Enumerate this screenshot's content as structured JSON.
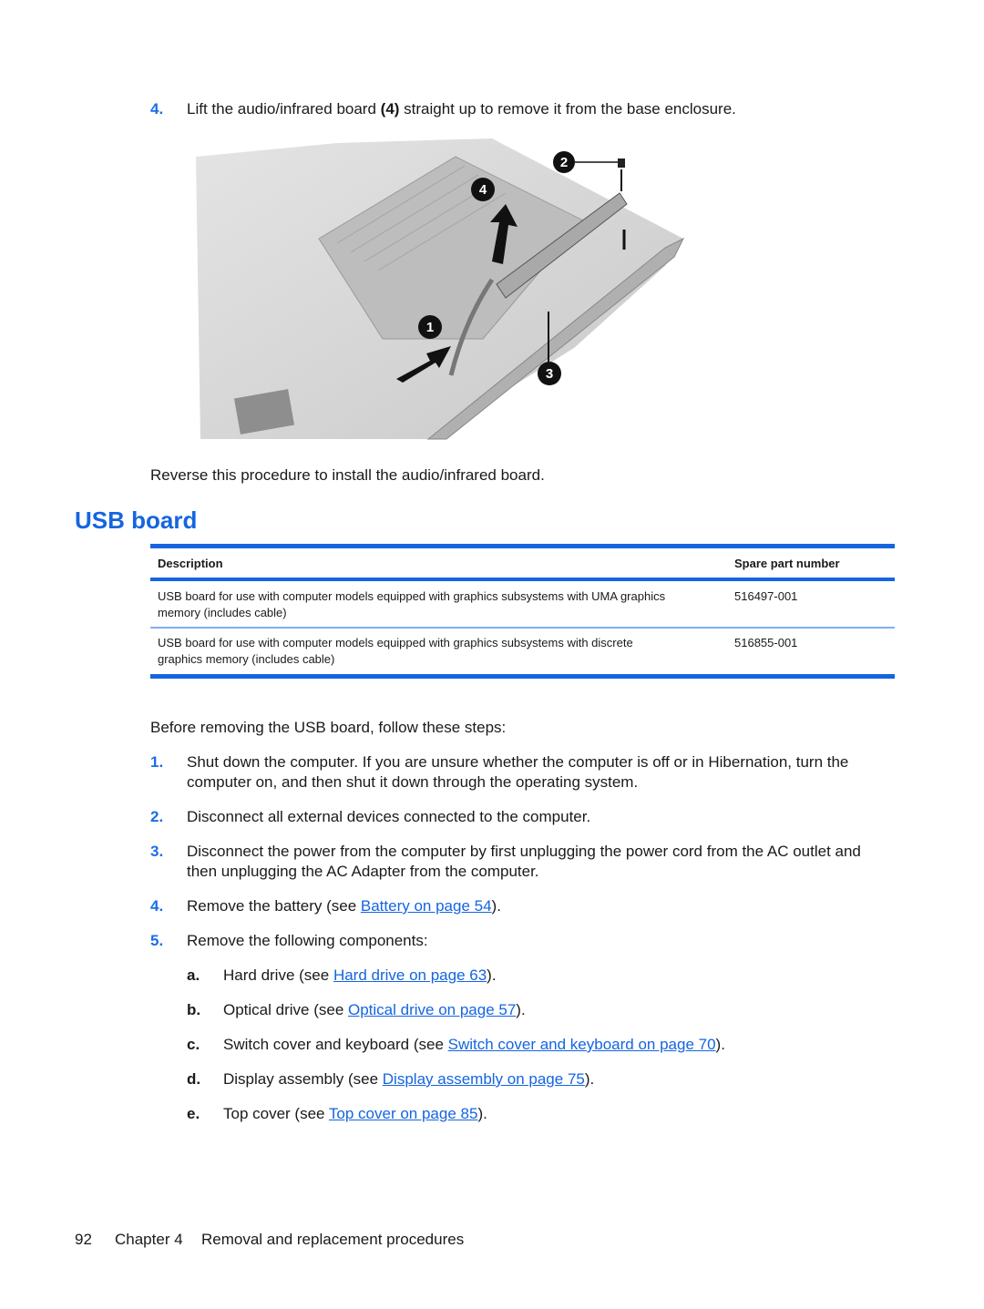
{
  "top_step": {
    "number": "4.",
    "text_before": "Lift the audio/infrared board ",
    "bold": "(4)",
    "text_after": " straight up to remove it from the base enclosure."
  },
  "figure": {
    "callouts": [
      "1",
      "2",
      "3",
      "4"
    ],
    "description": "Illustration of audio/infrared board removal from base enclosure"
  },
  "reverse_note": "Reverse this procedure to install the audio/infrared board.",
  "section_title": "USB board",
  "table": {
    "headers": [
      "Description",
      "Spare part number"
    ],
    "rows": [
      {
        "description_line1": "USB board for use with computer models equipped with graphics subsystems with UMA graphics",
        "description_line2": "memory (includes cable)",
        "part": "516497-001"
      },
      {
        "description_line1": "USB board for use with computer models equipped with graphics subsystems with discrete",
        "description_line2": "graphics memory (includes cable)",
        "part": "516855-001"
      }
    ]
  },
  "intro": "Before removing the USB board, follow these steps:",
  "steps": [
    {
      "number": "1.",
      "line1": "Shut down the computer. If you are unsure whether the computer is off or in Hibernation, turn the",
      "line2": "computer on, and then shut it down through the operating system."
    },
    {
      "number": "2.",
      "line1": "Disconnect all external devices connected to the computer."
    },
    {
      "number": "3.",
      "line1": "Disconnect the power from the computer by first unplugging the power cord from the AC outlet and",
      "line2": "then unplugging the AC Adapter from the computer."
    },
    {
      "number": "4.",
      "before": "Remove the battery (see ",
      "link": "Battery on page 54",
      "after": ")."
    },
    {
      "number": "5.",
      "line1": "Remove the following components:"
    }
  ],
  "substeps": [
    {
      "letter": "a.",
      "before": "Hard drive (see ",
      "link": "Hard drive on page 63",
      "after": ")."
    },
    {
      "letter": "b.",
      "before": "Optical drive (see ",
      "link": "Optical drive on page 57",
      "after": ")."
    },
    {
      "letter": "c.",
      "before": "Switch cover and keyboard (see ",
      "link": "Switch cover and keyboard on page 70",
      "after": ")."
    },
    {
      "letter": "d.",
      "before": "Display assembly (see ",
      "link": "Display assembly on page 75",
      "after": ")."
    },
    {
      "letter": "e.",
      "before": "Top cover (see ",
      "link": "Top cover on page 85",
      "after": ")."
    }
  ],
  "footer": {
    "page": "92",
    "chapter": "Chapter 4",
    "title": "Removal and replacement procedures"
  },
  "colors": {
    "accent": "#1565e0",
    "link": "#1565e0",
    "text": "#1a1a1a"
  }
}
